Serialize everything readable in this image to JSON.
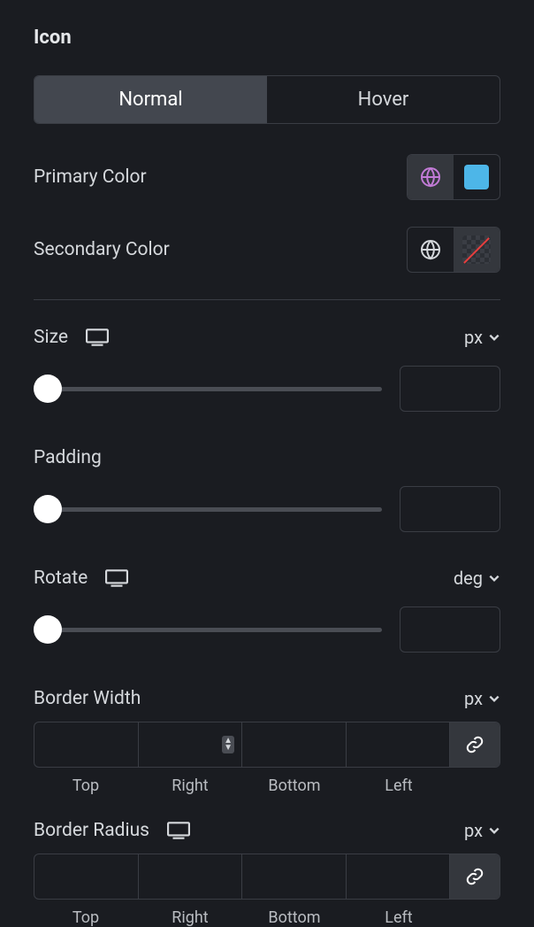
{
  "section_title": "Icon",
  "tabs": {
    "normal": "Normal",
    "hover": "Hover"
  },
  "primary_color": {
    "label": "Primary Color",
    "globe_color": "#c27bd6",
    "swatch": "#4db6e8"
  },
  "secondary_color": {
    "label": "Secondary Color",
    "globe_color": "#d5d8dc"
  },
  "size": {
    "label": "Size",
    "unit": "px",
    "value": ""
  },
  "padding": {
    "label": "Padding",
    "value": ""
  },
  "rotate": {
    "label": "Rotate",
    "unit": "deg",
    "value": ""
  },
  "border_width": {
    "label": "Border Width",
    "unit": "px",
    "sides": {
      "top": "Top",
      "right": "Right",
      "bottom": "Bottom",
      "left": "Left"
    },
    "values": {
      "top": "",
      "right": "",
      "bottom": "",
      "left": ""
    }
  },
  "border_radius": {
    "label": "Border Radius",
    "unit": "px",
    "sides": {
      "top": "Top",
      "right": "Right",
      "bottom": "Bottom",
      "left": "Left"
    },
    "values": {
      "top": "",
      "right": "",
      "bottom": "",
      "left": ""
    }
  }
}
